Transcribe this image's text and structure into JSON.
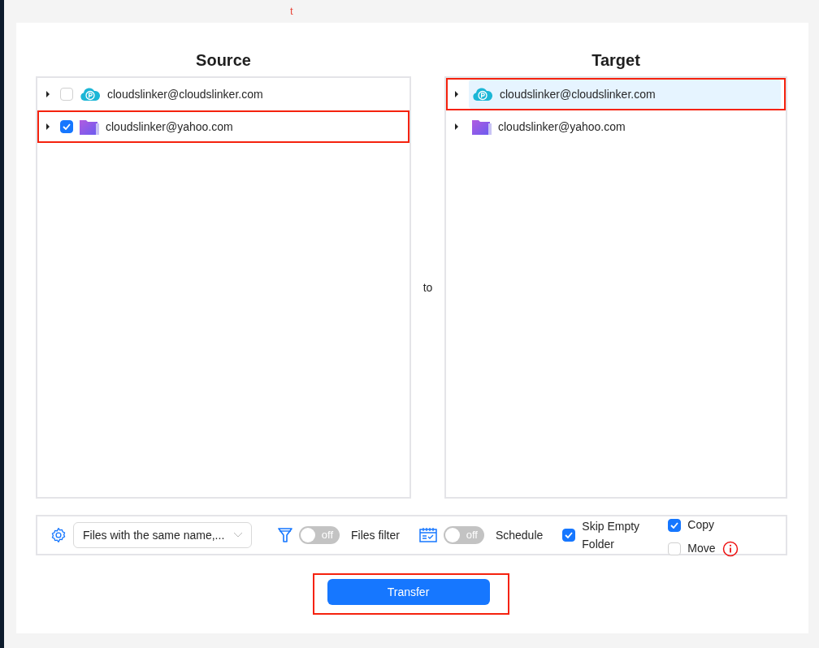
{
  "top_mark": "t",
  "source": {
    "title": "Source",
    "items": [
      {
        "label": "cloudslinker@cloudslinker.com",
        "kind": "cloud",
        "checked": false,
        "highlighted": false
      },
      {
        "label": "cloudslinker@yahoo.com",
        "kind": "folder",
        "checked": true,
        "highlighted": true
      }
    ]
  },
  "connector": "to",
  "target": {
    "title": "Target",
    "items": [
      {
        "label": "cloudslinker@cloudslinker.com",
        "kind": "cloud",
        "selected": true,
        "highlighted": true
      },
      {
        "label": "cloudslinker@yahoo.com",
        "kind": "folder",
        "selected": false,
        "highlighted": false
      }
    ]
  },
  "options": {
    "conflict_select": {
      "value": "Files with the same name,..."
    },
    "files_filter": {
      "toggle_text": "off",
      "on": false,
      "label": "Files filter"
    },
    "schedule": {
      "toggle_text": "off",
      "on": false,
      "label": "Schedule"
    },
    "skip_empty": {
      "label": "Skip Empty Folder",
      "checked": true
    },
    "copy": {
      "label": "Copy",
      "checked": true
    },
    "move": {
      "label": "Move",
      "checked": false
    }
  },
  "transfer_button": {
    "label": "Transfer",
    "highlighted": true
  }
}
